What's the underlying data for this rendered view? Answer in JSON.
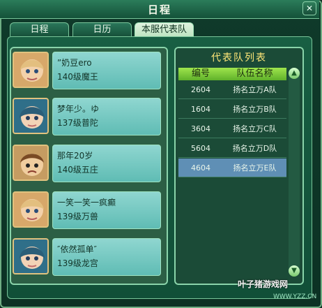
{
  "window": {
    "title": "日程"
  },
  "tabs": [
    {
      "label": "日程"
    },
    {
      "label": "日历"
    },
    {
      "label": "本服代表队"
    }
  ],
  "members": [
    {
      "name": "”奶豆ero",
      "level": "140级魔王"
    },
    {
      "name": "梦年少。ゆ",
      "level": "137级普陀"
    },
    {
      "name": "那年20岁",
      "level": "140级五庄"
    },
    {
      "name": "一笑一笑一疯癫",
      "level": "139级万兽"
    },
    {
      "name": "″依然孤单″",
      "level": "139级龙宫"
    }
  ],
  "teams_panel": {
    "title": "代表队列表",
    "columns": [
      "编号",
      "队伍名称"
    ],
    "rows": [
      [
        "2604",
        "扬名立万A队"
      ],
      [
        "1604",
        "扬名立万B队"
      ],
      [
        "3604",
        "扬名立万C队"
      ],
      [
        "5604",
        "扬名立万D队"
      ],
      [
        "4604",
        "扬名立万E队"
      ]
    ]
  },
  "watermark": {
    "brand": "叶子猪游戏网",
    "url": "WWW.YZZ.CN"
  }
}
